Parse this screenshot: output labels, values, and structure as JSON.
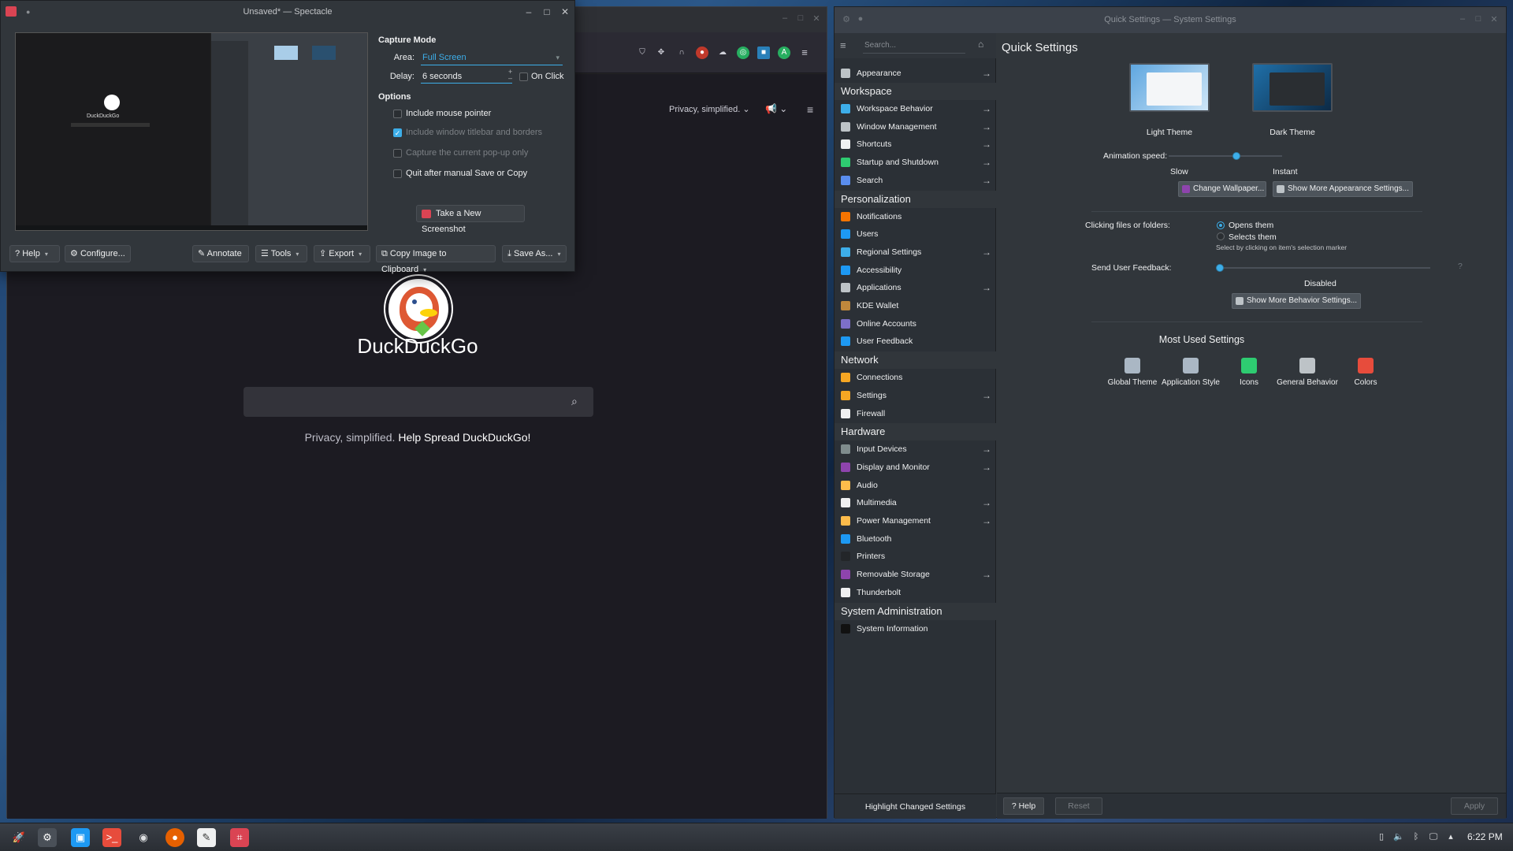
{
  "firefox": {
    "privacy_dropdown": "Privacy, simplified.",
    "brand": "DuckDuckGo",
    "tagline_plain": "Privacy, simplified.",
    "tagline_link": "Help Spread DuckDuckGo!",
    "icons": [
      "pocket-icon",
      "extension-icon",
      "headphones-icon",
      "ublock-icon",
      "cloud-icon",
      "green-circle-icon",
      "blue-square-icon",
      "avatar-icon",
      "menu-icon"
    ]
  },
  "spectacle": {
    "title": "Unsaved* — Spectacle",
    "capture_mode_heading": "Capture Mode",
    "area_label": "Area:",
    "area_value": "Full Screen",
    "delay_label": "Delay:",
    "delay_value": "6 seconds",
    "on_click_label": "On Click",
    "options_heading": "Options",
    "options": [
      {
        "label": "Include mouse pointer",
        "checked": false,
        "enabled": true
      },
      {
        "label": "Include window titlebar and borders",
        "checked": true,
        "enabled": false
      },
      {
        "label": "Capture the current pop-up only",
        "checked": false,
        "enabled": false
      },
      {
        "label": "Quit after manual Save or Copy",
        "checked": false,
        "enabled": true
      }
    ],
    "take_screenshot": "Take a New Screenshot",
    "preview_brand": "DuckDuckGo",
    "buttons": {
      "help": "Help",
      "configure": "Configure...",
      "annotate": "Annotate",
      "tools": "Tools",
      "export": "Export",
      "copy_clipboard": "Copy Image to Clipboard",
      "save_as": "Save As..."
    }
  },
  "settings": {
    "title": "Quick Settings — System Settings",
    "search_placeholder": "Search...",
    "sidebar": {
      "appearance": "Appearance",
      "sections": [
        {
          "title": "Workspace",
          "items": [
            {
              "label": "Workspace Behavior",
              "arrow": true,
              "color": "#3daee9"
            },
            {
              "label": "Window Management",
              "arrow": true,
              "color": "#bdc3c7"
            },
            {
              "label": "Shortcuts",
              "arrow": true,
              "color": "#eff0f1"
            },
            {
              "label": "Startup and Shutdown",
              "arrow": true,
              "color": "#2ecc71"
            },
            {
              "label": "Search",
              "arrow": true,
              "color": "#5a8dee"
            }
          ]
        },
        {
          "title": "Personalization",
          "items": [
            {
              "label": "Notifications",
              "arrow": false,
              "color": "#f67400"
            },
            {
              "label": "Users",
              "arrow": false,
              "color": "#1d99f3"
            },
            {
              "label": "Regional Settings",
              "arrow": true,
              "color": "#3daee9"
            },
            {
              "label": "Accessibility",
              "arrow": false,
              "color": "#1d99f3"
            },
            {
              "label": "Applications",
              "arrow": true,
              "color": "#bdc3c7"
            },
            {
              "label": "KDE Wallet",
              "arrow": false,
              "color": "#c0883c"
            },
            {
              "label": "Online Accounts",
              "arrow": false,
              "color": "#7d6fc9"
            },
            {
              "label": "User Feedback",
              "arrow": false,
              "color": "#1d99f3"
            }
          ]
        },
        {
          "title": "Network",
          "items": [
            {
              "label": "Connections",
              "arrow": false,
              "color": "#f5a623"
            },
            {
              "label": "Settings",
              "arrow": true,
              "color": "#f5a623"
            },
            {
              "label": "Firewall",
              "arrow": false,
              "color": "#eff0f1"
            }
          ]
        },
        {
          "title": "Hardware",
          "items": [
            {
              "label": "Input Devices",
              "arrow": true,
              "color": "#7f8c8d"
            },
            {
              "label": "Display and Monitor",
              "arrow": true,
              "color": "#8e44ad"
            },
            {
              "label": "Audio",
              "arrow": false,
              "color": "#fdbc4b"
            },
            {
              "label": "Multimedia",
              "arrow": true,
              "color": "#eff0f1"
            },
            {
              "label": "Power Management",
              "arrow": true,
              "color": "#fdbc4b"
            },
            {
              "label": "Bluetooth",
              "arrow": false,
              "color": "#1d99f3"
            },
            {
              "label": "Printers",
              "arrow": false,
              "color": "#232629"
            },
            {
              "label": "Removable Storage",
              "arrow": true,
              "color": "#8e44ad"
            },
            {
              "label": "Thunderbolt",
              "arrow": false,
              "color": "#eff0f1"
            }
          ]
        },
        {
          "title": "System Administration",
          "items": [
            {
              "label": "System Information",
              "arrow": false,
              "color": "#111111"
            }
          ]
        }
      ],
      "highlight_changed": "Highlight Changed Settings"
    },
    "main": {
      "page_title": "Quick Settings",
      "light_theme": "Light Theme",
      "dark_theme": "Dark Theme",
      "animation_speed_label": "Animation speed:",
      "animation_speed_value": 0.6,
      "slow": "Slow",
      "instant": "Instant",
      "change_wallpaper": "Change Wallpaper...",
      "more_appearance": "Show More Appearance Settings...",
      "clicking_label": "Clicking files or folders:",
      "opens_them": "Opens them",
      "selects_them": "Selects them",
      "selection_hint": "Select by clicking on item's selection marker",
      "feedback_label": "Send User Feedback:",
      "feedback_value": "Disabled",
      "feedback_help": "?",
      "more_behavior": "Show More Behavior Settings...",
      "most_used_heading": "Most Used Settings",
      "most_used": [
        {
          "label": "Global Theme",
          "color": "#aab7c4"
        },
        {
          "label": "Application Style",
          "color": "#aab7c4"
        },
        {
          "label": "Icons",
          "color": "#2ecc71"
        },
        {
          "label": "General Behavior",
          "color": "#bdc3c7"
        },
        {
          "label": "Colors",
          "color": "#e74c3c"
        }
      ]
    },
    "bottom": {
      "help": "Help",
      "reset": "Reset",
      "apply": "Apply"
    }
  },
  "taskbar": {
    "apps": [
      "launcher-icon",
      "system-settings-icon",
      "discover-icon",
      "terminal-icon",
      "steam-icon",
      "firefox-icon",
      "text-editor-icon",
      "spectacle-icon"
    ],
    "clock": "6:22 PM"
  }
}
